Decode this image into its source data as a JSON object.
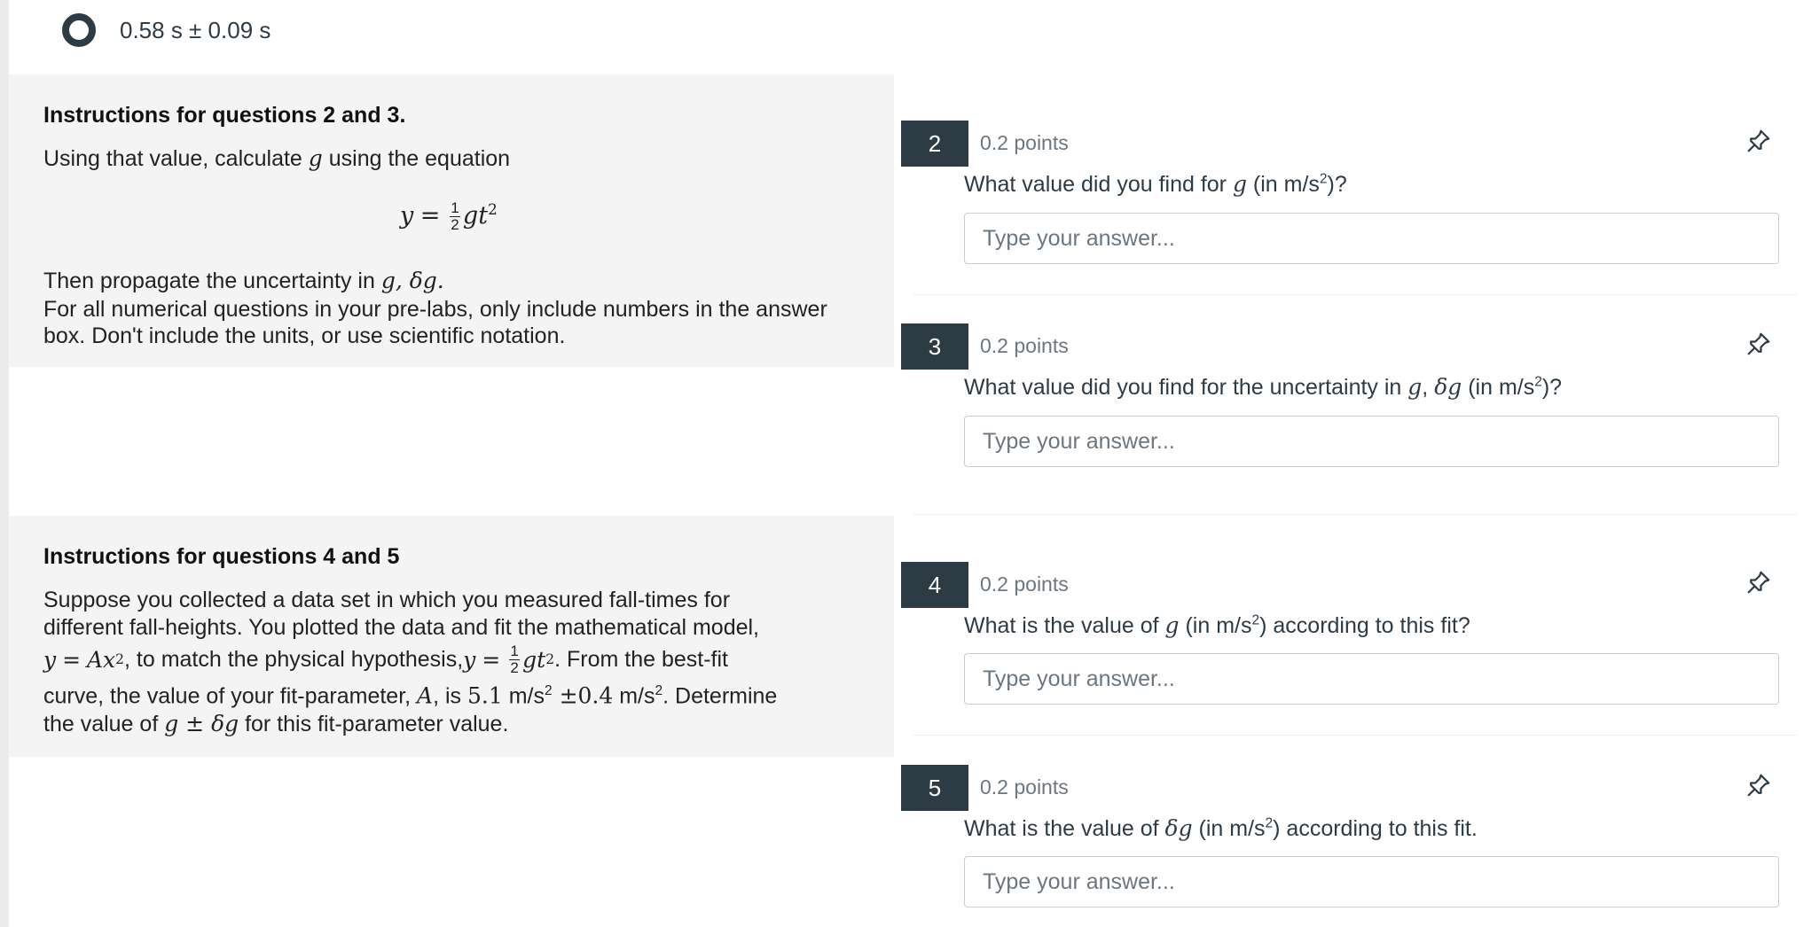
{
  "prev_option": {
    "label": "0.58 s ± 0.09 s"
  },
  "instructions_2_3": {
    "title": "Instructions for questions 2 and 3.",
    "line1_before": "Using that value, calculate ",
    "line1_var": "g",
    "line1_after": " using the equation",
    "line3_before": "Then propagate the uncertainty in ",
    "line3_math": "g, δg.",
    "line4": "For all numerical questions in your pre-labs, only include numbers in the answer box. Don't include the units, or use scientific notation."
  },
  "instructions_4_5": {
    "title": "Instructions for questions 4 and 5",
    "l1": "Suppose you collected a data set in which you measured fall-times for",
    "l2": "different fall-heights. You plotted the data and fit the mathematical model,",
    "l3_after_model": ", to match the physical hypothesis, ",
    "l3_end": ". From the best-fit",
    "l4_start": "curve, the value of your fit-parameter, ",
    "l4_A": "A",
    "l4_is": ", is ",
    "l4_val": "5.1",
    "l4_unit": " m/s",
    "l4_pm": " ±0.4",
    "l4_end": ". Determine",
    "l5_start": "the value of ",
    "l5_math": "g ± δg",
    "l5_end": " for this fit-parameter value."
  },
  "questions": [
    {
      "number": "2",
      "points": "0.2 points",
      "placeholder": "Type your answer..."
    },
    {
      "number": "3",
      "points": "0.2 points",
      "placeholder": "Type your answer..."
    },
    {
      "number": "4",
      "points": "0.2 points",
      "placeholder": "Type your answer..."
    },
    {
      "number": "5",
      "points": "0.2 points",
      "placeholder": "Type your answer..."
    }
  ],
  "icons": {
    "pin": "pin-icon",
    "radio": "radio-selected-icon"
  }
}
